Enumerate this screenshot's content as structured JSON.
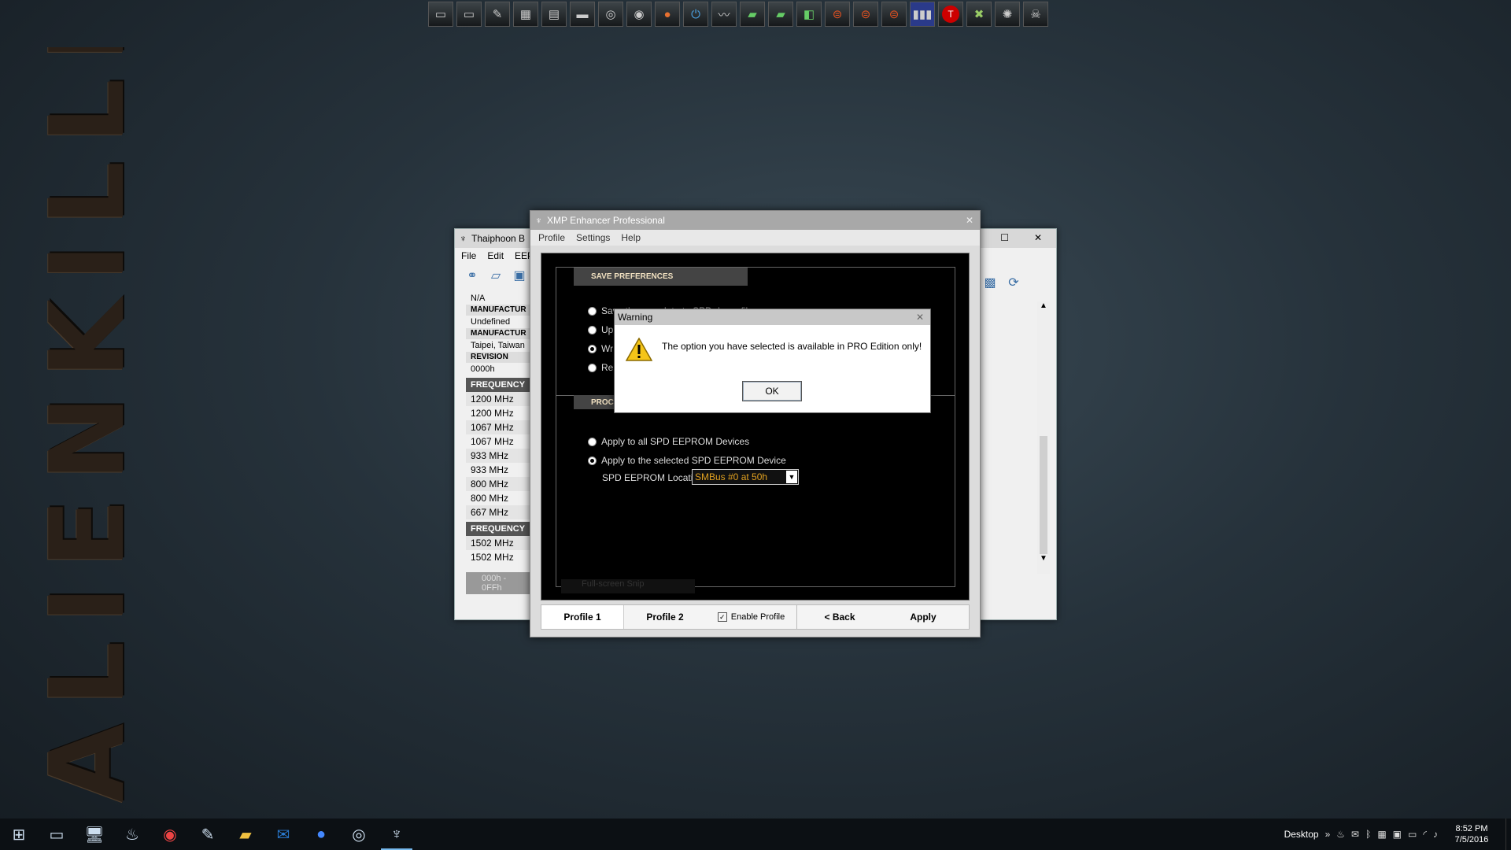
{
  "wallpaper": {
    "text": "ALIENKILLER"
  },
  "dock": {
    "icons": [
      "drive-icon",
      "drive-icon",
      "pen-icon",
      "chip-icon",
      "board-icon",
      "cpu-icon",
      "circle-icon",
      "gauge-icon",
      "orange-icon",
      "power-icon",
      "wave-icon",
      "gpu-icon",
      "gpu-icon",
      "card-icon",
      "disc-icon",
      "disc-icon",
      "disc-icon",
      "bars-icon",
      "t-icon",
      "x-icon",
      "gear-icon",
      "skull-icon"
    ]
  },
  "thaiphoon": {
    "title": "Thaiphoon B",
    "menu": [
      "File",
      "Edit",
      "EEPR"
    ],
    "info": [
      {
        "value": "N/A"
      },
      {
        "head": "MANUFACTUR",
        "value": "Undefined"
      },
      {
        "head": "MANUFACTUR",
        "value": "Taipei, Taiwan"
      },
      {
        "head": "REVISION",
        "value": "0000h"
      }
    ],
    "freq_head_1": "FREQUENCY",
    "freqs_1": [
      "1200 MHz",
      "1200 MHz",
      "1067 MHz",
      "1067 MHz",
      "933 MHz",
      "933 MHz",
      "800 MHz",
      "800 MHz",
      "667 MHz"
    ],
    "freq_head_2": "FREQUENCY",
    "freqs_2": [
      "1502 MHz",
      "1502 MHz"
    ],
    "bottom_bar": "000h - 0FFh"
  },
  "xmp": {
    "title": "XMP Enhancer Professional",
    "menu": [
      "Profile",
      "Settings",
      "Help"
    ],
    "save_pref_label": "SAVE PREFERENCES",
    "options": [
      "Save the new data to SPD dump file",
      "Up",
      "Wr",
      "Re"
    ],
    "proc_label": "PROC",
    "apply_all": "Apply to all SPD EEPROM Devices",
    "apply_selected": "Apply to the selected SPD EEPROM Device",
    "spd_location_label": "SPD EEPROM Location",
    "spd_location_value": "SMBus #0 at 50h",
    "fullscreen_snap": "Full-screen Snip",
    "footer": {
      "profile1": "Profile 1",
      "profile2": "Profile 2",
      "enable_profile": "Enable Profile",
      "back": "< Back",
      "apply": "Apply"
    }
  },
  "warning": {
    "title": "Warning",
    "message": "The option you have selected is available in PRO Edition only!",
    "ok": "OK"
  },
  "taskbar": {
    "desktop_label": "Desktop",
    "time": "8:52 PM",
    "date": "7/5/2016"
  }
}
